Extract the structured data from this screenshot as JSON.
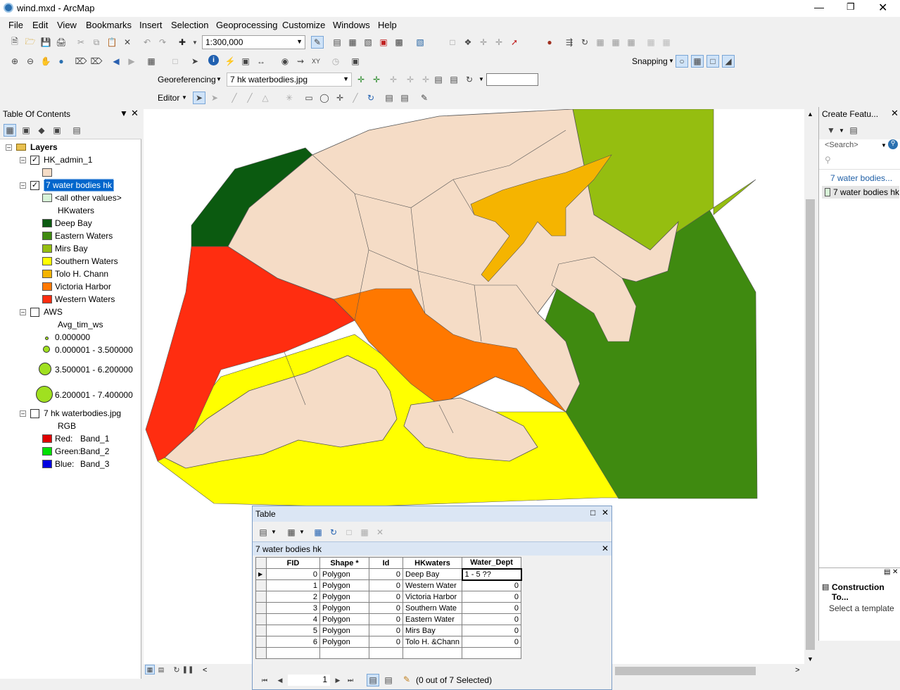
{
  "window": {
    "title": "wind.mxd - ArcMap"
  },
  "menu": [
    "File",
    "Edit",
    "View",
    "Bookmarks",
    "Insert",
    "Selection",
    "Geoprocessing",
    "Customize",
    "Windows",
    "Help"
  ],
  "toolbar": {
    "scale": "1:300,000"
  },
  "snapping": {
    "label": "Snapping"
  },
  "georef": {
    "label": "Georeferencing",
    "layer": "7 hk waterbodies.jpg"
  },
  "editor": {
    "label": "Editor"
  },
  "toc": {
    "title": "Table Of Contents",
    "layers_label": "Layers",
    "admin": {
      "name": "HK_admin_1",
      "color": "#f5dcc6"
    },
    "water": {
      "name": "7 water bodies hk",
      "other": "<all other values>",
      "field": "HKwaters",
      "classes": [
        {
          "label": "Deep Bay",
          "color": "#0b5a10"
        },
        {
          "label": "Eastern Waters",
          "color": "#3f8a10"
        },
        {
          "label": "Mirs Bay",
          "color": "#95be10"
        },
        {
          "label": "Southern Waters",
          "color": "#ffff00"
        },
        {
          "label": "Tolo H. Chann",
          "color": "#f5b400"
        },
        {
          "label": "Victoria Harbor",
          "color": "#ff7800"
        },
        {
          "label": "Western Waters",
          "color": "#ff2d10"
        }
      ]
    },
    "aws": {
      "name": "AWS",
      "field": "Avg_tim_ws",
      "classes": [
        "0.000000",
        "0.000001 - 3.500000",
        "3.500001 - 6.200000",
        "6.200001 - 7.400000"
      ]
    },
    "raster": {
      "name": "7 hk waterbodies.jpg",
      "label": "RGB",
      "bands": [
        {
          "ch": "Red:",
          "band": "Band_1",
          "color": "#e00000"
        },
        {
          "ch": "Green:",
          "band": "Band_2",
          "color": "#00e000"
        },
        {
          "ch": "Blue:",
          "band": "Band_3",
          "color": "#0000e0"
        }
      ]
    }
  },
  "create_features": {
    "title": "Create Featu...",
    "search": "<Search>",
    "group": "7 water bodies...",
    "template": "7 water bodies hk"
  },
  "construction": {
    "title": "Construction To...",
    "hint": "Select a template"
  },
  "table": {
    "title": "Table",
    "layer": "7 water bodies hk",
    "columns": [
      "FID",
      "Shape *",
      "Id",
      "HKwaters",
      "Water_Dept"
    ],
    "rows": [
      [
        "0",
        "Polygon",
        "0",
        "Deep Bay",
        "1 - 5 ??"
      ],
      [
        "1",
        "Polygon",
        "0",
        "Western Water",
        "0"
      ],
      [
        "2",
        "Polygon",
        "0",
        "Victoria Harbor",
        "0"
      ],
      [
        "3",
        "Polygon",
        "0",
        "Southern Wate",
        "0"
      ],
      [
        "4",
        "Polygon",
        "0",
        "Eastern Water",
        "0"
      ],
      [
        "5",
        "Polygon",
        "0",
        "Mirs Bay",
        "0"
      ],
      [
        "6",
        "Polygon",
        "0",
        "Tolo H. &Chann",
        "0"
      ]
    ],
    "record": "1",
    "selected": "(0 out of 7 Selected)"
  }
}
